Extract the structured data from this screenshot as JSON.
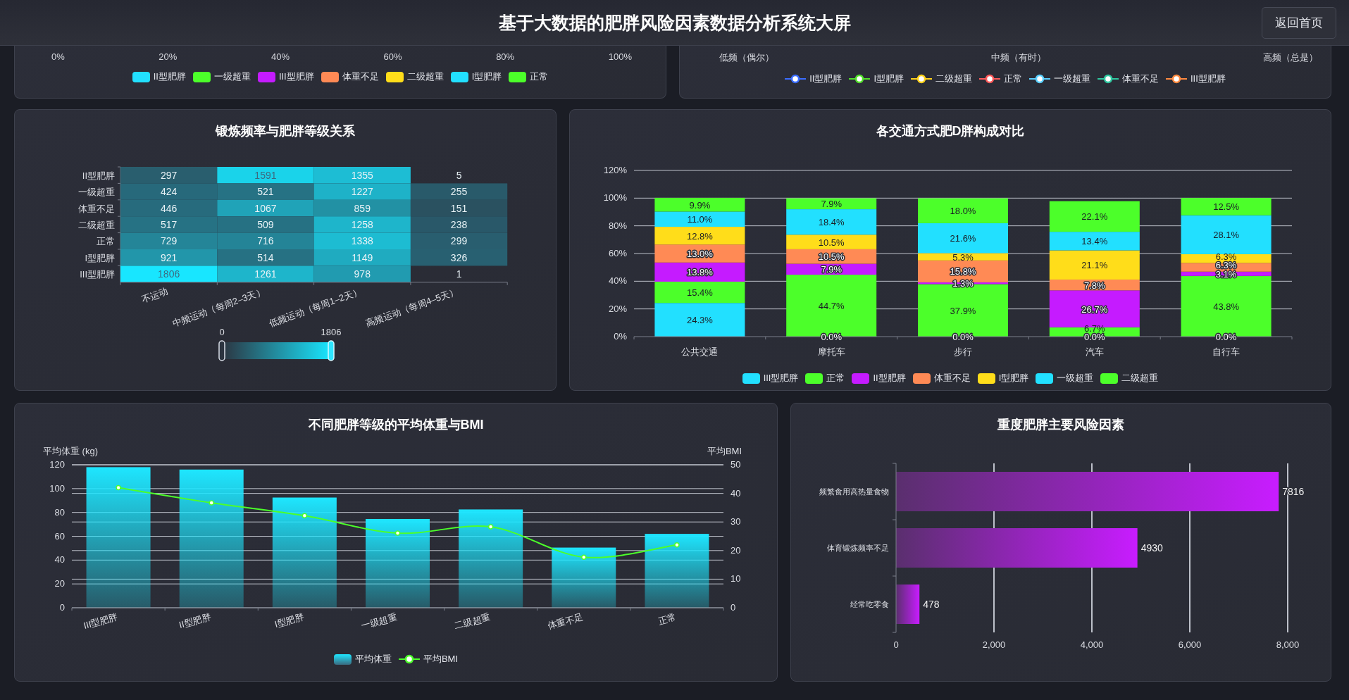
{
  "header": {
    "title": "基于大数据的肥胖风险因素数据分析系统大屏",
    "button": "返回首页"
  },
  "top_left_panel": {
    "axis_labels": [
      "0%",
      "20%",
      "40%",
      "60%",
      "80%",
      "100%"
    ],
    "legend": [
      {
        "label": "II型肥胖",
        "color": "#22e0ff"
      },
      {
        "label": "一级超重",
        "color": "#4cff2a"
      },
      {
        "label": "III型肥胖",
        "color": "#c51bff"
      },
      {
        "label": "体重不足",
        "color": "#ff8a55"
      },
      {
        "label": "二级超重",
        "color": "#ffdd1a"
      },
      {
        "label": "I型肥胖",
        "color": "#22e0ff"
      },
      {
        "label": "正常",
        "color": "#4cff2a"
      }
    ]
  },
  "top_right_panel": {
    "axis_labels": [
      "低频（偶尔）",
      "中频（有时）",
      "高频（总是）"
    ],
    "legend": [
      {
        "label": "II型肥胖",
        "color": "#3b6dff"
      },
      {
        "label": "I型肥胖",
        "color": "#52e02a"
      },
      {
        "label": "二级超重",
        "color": "#ffd21a"
      },
      {
        "label": "正常",
        "color": "#ff5a5a"
      },
      {
        "label": "一级超重",
        "color": "#5ad0ff"
      },
      {
        "label": "体重不足",
        "color": "#2ec8a0"
      },
      {
        "label": "III型肥胖",
        "color": "#ff8a40"
      }
    ]
  },
  "heatmap_panel": {
    "title": "锻炼频率与肥胖等级关系",
    "rows": [
      "II型肥胖",
      "一级超重",
      "体重不足",
      "二级超重",
      "正常",
      "I型肥胖",
      "III型肥胖"
    ],
    "columns": [
      "不运动",
      "中频运动（每周2–3天）",
      "低频运动（每周1–2天）",
      "高频运动（每周4–5天）"
    ],
    "cells": [
      [
        "297",
        "1591",
        "1355",
        "5"
      ],
      [
        "424",
        "521",
        "1227",
        "255"
      ],
      [
        "446",
        "1067",
        "859",
        "151"
      ],
      [
        "517",
        "509",
        "1258",
        "238"
      ],
      [
        "729",
        "716",
        "1338",
        "299"
      ],
      [
        "921",
        "514",
        "1149",
        "326"
      ],
      [
        "1806",
        "1261",
        "978",
        "1"
      ]
    ],
    "visual_map": {
      "min": "0",
      "max": "1806"
    }
  },
  "transport_panel": {
    "chart_data": {
      "type": "bar",
      "title": "各交通方式肥D胖构成对比",
      "stacked": true,
      "data_labels": true,
      "grid": true,
      "legend": true,
      "categories": [
        "公共交通",
        "摩托车",
        "步行",
        "汽车",
        "自行车"
      ],
      "ylim": [
        0,
        120
      ],
      "yticks": [
        {
          "value": 0,
          "label": "0%"
        },
        {
          "value": 20,
          "label": "20%"
        },
        {
          "value": 40,
          "label": "40%"
        },
        {
          "value": 60,
          "label": "60%"
        },
        {
          "value": 80,
          "label": "80%"
        },
        {
          "value": 100,
          "label": "100%"
        },
        {
          "value": 120,
          "label": "120%"
        }
      ],
      "series": [
        {
          "name": "III型肥胖",
          "color": "#22e0ff",
          "values": [
            24.3,
            0.0,
            0.0,
            0.0,
            0.0
          ],
          "value_labels": [
            "24.3%",
            "0.0%",
            "0.0%",
            "0.0%",
            "0.0%"
          ]
        },
        {
          "name": "正常",
          "color": "#4cff2a",
          "values": [
            15.4,
            44.7,
            37.9,
            6.7,
            43.8
          ],
          "value_labels": [
            "15.4%",
            "44.7%",
            "37.9%",
            "6.7%",
            "43.8%"
          ]
        },
        {
          "name": "II型肥胖",
          "color": "#c51bff",
          "values": [
            13.8,
            7.9,
            1.3,
            26.7,
            3.1
          ],
          "value_labels": [
            "13.8%",
            "7.9%",
            "1.3%",
            "26.7%",
            "3.1%"
          ]
        },
        {
          "name": "体重不足",
          "color": "#ff8a55",
          "values": [
            13.0,
            10.5,
            15.8,
            7.8,
            6.3
          ],
          "value_labels": [
            "13.0%",
            "10.5%",
            "15.8%",
            "7.8%",
            "6.3%"
          ]
        },
        {
          "name": "I型肥胖",
          "color": "#ffdd1a",
          "values": [
            12.8,
            10.5,
            5.3,
            21.1,
            6.3
          ],
          "value_labels": [
            "12.8%",
            "10.5%",
            "5.3%",
            "21.1%",
            "6.3%"
          ]
        },
        {
          "name": "一级超重",
          "color": "#22e0ff",
          "values": [
            11.0,
            18.4,
            21.6,
            13.4,
            28.1
          ],
          "value_labels": [
            "11.0%",
            "18.4%",
            "21.6%",
            "13.4%",
            "28.1%"
          ]
        },
        {
          "name": "二级超重",
          "color": "#4cff2a",
          "values": [
            9.9,
            7.9,
            18.0,
            22.1,
            12.5
          ],
          "value_labels": [
            "9.9%",
            "7.9%",
            "18.0%",
            "22.1%",
            "12.5%"
          ]
        }
      ]
    }
  },
  "weight_bmi_panel": {
    "chart_data": {
      "type": "bar",
      "title": "不同肥胖等级的平均体重与BMI",
      "ylabel": "平均体重 (kg)",
      "y2label": "平均BMI",
      "grid": true,
      "legend": true,
      "categories": [
        "III型肥胖",
        "II型肥胖",
        "I型肥胖",
        "一级超重",
        "二级超重",
        "体重不足",
        "正常"
      ],
      "ylim": [
        0,
        120
      ],
      "yticks": [
        0,
        20,
        40,
        60,
        80,
        100,
        120
      ],
      "y2lim": [
        0,
        50
      ],
      "y2ticks": [
        0,
        10,
        20,
        30,
        40,
        50
      ],
      "series": [
        {
          "name": "平均体重",
          "type": "bar",
          "color": "#1ee6ff",
          "values": [
            118,
            116,
            92.5,
            74.5,
            82.5,
            50.5,
            62
          ]
        },
        {
          "name": "平均BMI",
          "type": "line",
          "axis": "y2",
          "marker": true,
          "color": "#4cff2a",
          "values": [
            42,
            36.7,
            32.2,
            26.1,
            28.3,
            17.7,
            22
          ]
        }
      ]
    }
  },
  "risk_panel": {
    "chart_data": {
      "type": "bar",
      "orientation": "horizontal",
      "title": "重度肥胖主要风险因素",
      "data_labels": true,
      "grid": true,
      "categories": [
        "频繁食用高热量食物",
        "体育锻炼频率不足",
        "经常吃零食"
      ],
      "xlim": [
        0,
        8000
      ],
      "xticks": [
        {
          "value": 0,
          "label": "0"
        },
        {
          "value": 2000,
          "label": "2,000"
        },
        {
          "value": 4000,
          "label": "4,000"
        },
        {
          "value": 6000,
          "label": "6,000"
        },
        {
          "value": 8000,
          "label": "8,000"
        }
      ],
      "series": [
        {
          "color": "#c81cff",
          "values": [
            7816,
            4930,
            478
          ],
          "value_labels": [
            "7816",
            "4930",
            "478"
          ]
        }
      ]
    }
  }
}
